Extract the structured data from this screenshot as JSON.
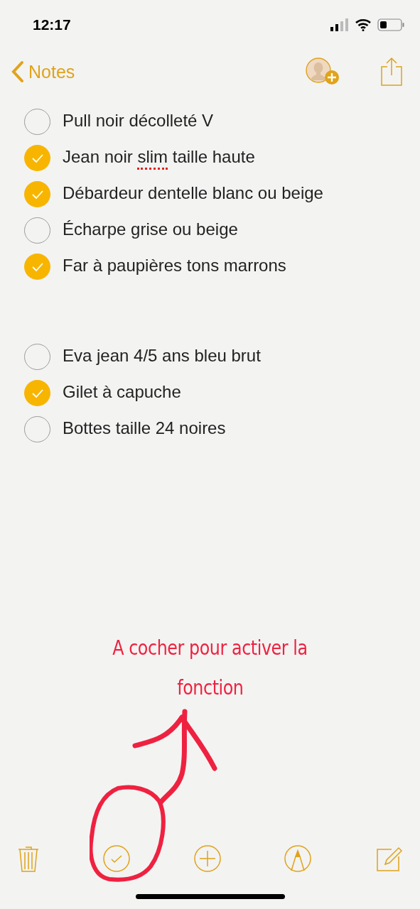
{
  "status_bar": {
    "time": "12:17"
  },
  "nav": {
    "back_label": "Notes"
  },
  "checklist_groups": [
    {
      "items": [
        {
          "segments": [
            {
              "text": "Pull noir décolleté V",
              "misspelled": false
            }
          ],
          "checked": false
        },
        {
          "segments": [
            {
              "text": "Jean noir ",
              "misspelled": false
            },
            {
              "text": "slim",
              "misspelled": true
            },
            {
              "text": " taille haute",
              "misspelled": false
            }
          ],
          "checked": true
        },
        {
          "segments": [
            {
              "text": "Débardeur dentelle blanc ou beige",
              "misspelled": false
            }
          ],
          "checked": true
        },
        {
          "segments": [
            {
              "text": "Écharpe grise ou beige",
              "misspelled": false
            }
          ],
          "checked": false
        },
        {
          "segments": [
            {
              "text": "Far à paupières tons marrons",
              "misspelled": false
            }
          ],
          "checked": true
        }
      ]
    },
    {
      "items": [
        {
          "segments": [
            {
              "text": "Eva jean 4/5 ans bleu brut",
              "misspelled": false
            }
          ],
          "checked": false
        },
        {
          "segments": [
            {
              "text": "Gilet à capuche",
              "misspelled": false
            }
          ],
          "checked": true
        },
        {
          "segments": [
            {
              "text": "Bottes taille 24 noires",
              "misspelled": false
            }
          ],
          "checked": false
        }
      ]
    }
  ],
  "annotation": {
    "lines": [
      "A cocher pour activer la",
      "fonction"
    ]
  },
  "toolbar": {
    "buttons": [
      {
        "kind": "trash"
      },
      {
        "kind": "checklist"
      },
      {
        "kind": "add"
      },
      {
        "kind": "markup"
      },
      {
        "kind": "compose"
      }
    ]
  }
}
